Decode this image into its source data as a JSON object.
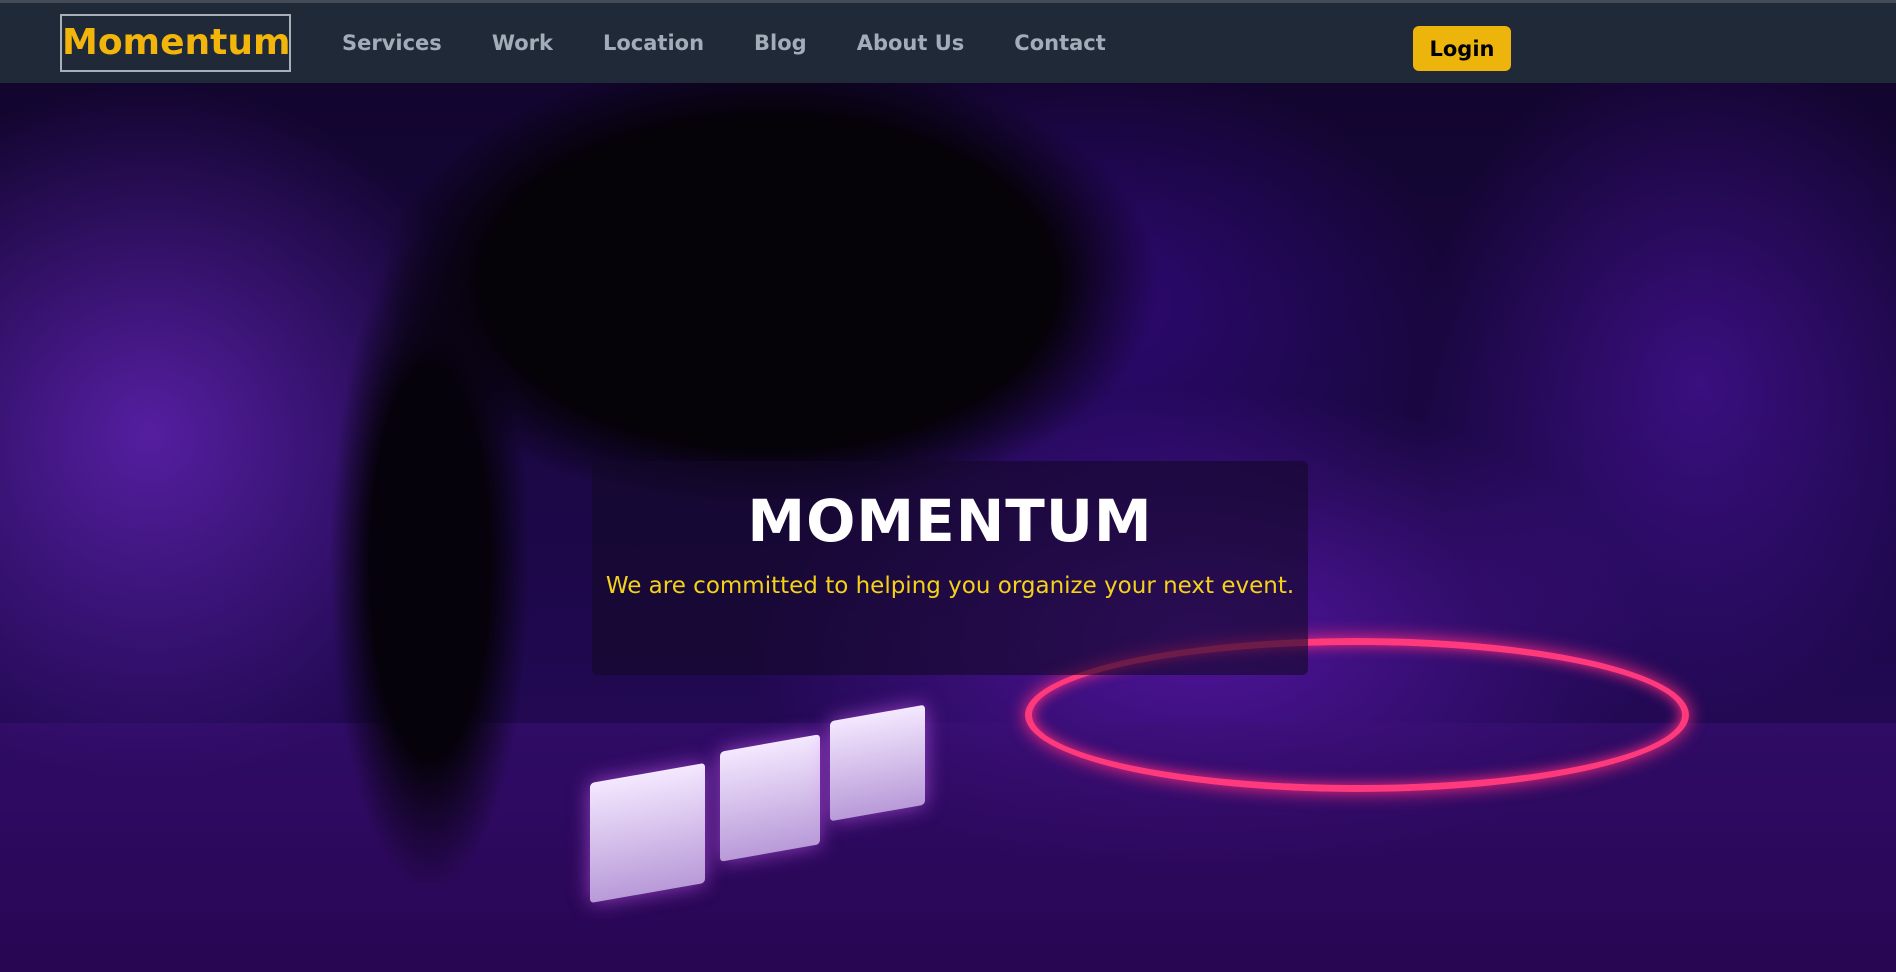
{
  "nav": {
    "logo": "Momentum",
    "links": [
      "Services",
      "Work",
      "Location",
      "Blog",
      "About Us",
      "Contact"
    ],
    "login": "Login"
  },
  "hero": {
    "title": "MOMENTUM",
    "subtitle": "We are committed to helping you organize your next event."
  },
  "colors": {
    "accent": "#edb40c",
    "nav_bg": "#202938",
    "subtitle": "#f4d21a"
  }
}
